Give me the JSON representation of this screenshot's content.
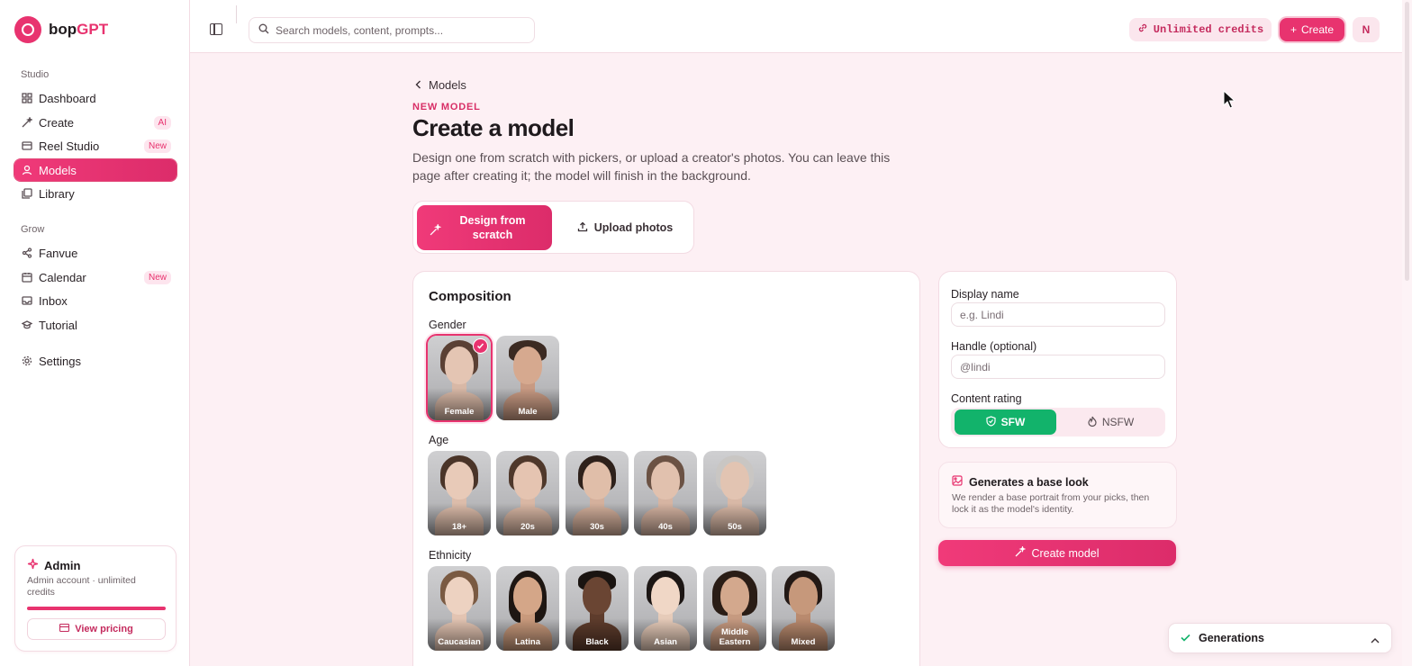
{
  "brand": {
    "name_main": "bop",
    "name_accent": "GPT"
  },
  "sidebar": {
    "studio_label": "Studio",
    "studio_items": [
      {
        "label": "Dashboard",
        "icon": "grid-icon",
        "badge": ""
      },
      {
        "label": "Create",
        "icon": "wand-icon",
        "badge": "AI"
      },
      {
        "label": "Reel Studio",
        "icon": "film-icon",
        "badge": "New"
      },
      {
        "label": "Models",
        "icon": "user-icon",
        "badge": "",
        "active": true
      },
      {
        "label": "Library",
        "icon": "images-icon",
        "badge": ""
      }
    ],
    "grow_label": "Grow",
    "grow_items": [
      {
        "label": "Fanvue",
        "icon": "share-icon",
        "badge": ""
      },
      {
        "label": "Calendar",
        "icon": "calendar-icon",
        "badge": "New"
      },
      {
        "label": "Inbox",
        "icon": "inbox-icon",
        "badge": ""
      },
      {
        "label": "Tutorial",
        "icon": "graduation-cap-icon",
        "badge": ""
      }
    ],
    "settings_label": "Settings",
    "admin": {
      "title": "Admin",
      "description": "Admin account · unlimited credits",
      "progress": 1.0,
      "pricing_label": "View pricing"
    }
  },
  "topbar": {
    "search_placeholder": "Search models, content, prompts...",
    "credits_label": "Unlimited credits",
    "create_label": "Create",
    "avatar_initial": "N"
  },
  "main": {
    "breadcrumb": "Models",
    "eyebrow": "NEW MODEL",
    "title": "Create a model",
    "description": "Design one from scratch with pickers, or upload a creator's photos. You can leave this page after creating it; the model will finish in the background.",
    "tabs": {
      "design": "Design from scratch",
      "upload": "Upload photos"
    },
    "composition": {
      "title": "Composition",
      "gender_label": "Gender",
      "gender_options": [
        "Female",
        "Male"
      ],
      "gender_selected": "Female",
      "age_label": "Age",
      "age_options": [
        "18+",
        "20s",
        "30s",
        "40s",
        "50s"
      ],
      "ethnicity_label": "Ethnicity",
      "ethnicity_options": [
        "Caucasian",
        "Latina",
        "Black",
        "Asian",
        "Middle Eastern",
        "Mixed"
      ]
    },
    "form": {
      "display_name_label": "Display name",
      "display_name_placeholder": "e.g. Lindi",
      "handle_label": "Handle (optional)",
      "handle_placeholder": "@lindi",
      "rating_label": "Content rating",
      "rating_sfw": "SFW",
      "rating_nsfw": "NSFW",
      "rating_selected": "SFW"
    },
    "info": {
      "title": "Generates a base look",
      "description": "We render a base portrait from your picks, then lock it as the model's identity."
    },
    "create_button": "Create model"
  },
  "generations": {
    "label": "Generations"
  },
  "colors": {
    "accent": "#e8336f",
    "sfw_green": "#12b36b",
    "background": "#fdf0f4"
  }
}
